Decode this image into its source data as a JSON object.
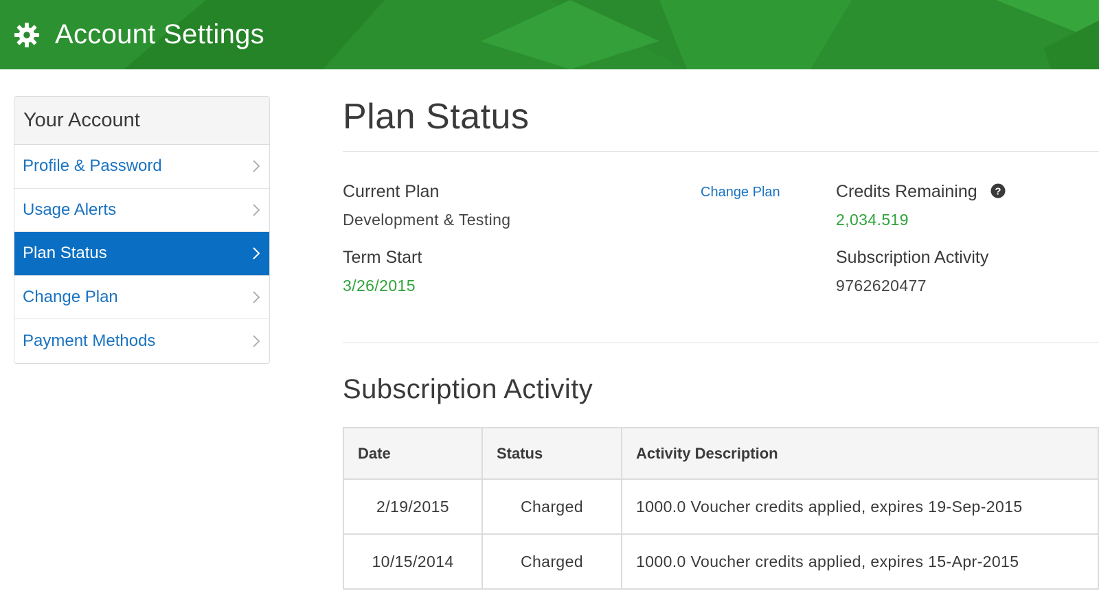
{
  "header": {
    "title": "Account Settings",
    "icon": "gear-icon",
    "color": "#2a8a2e"
  },
  "sidebar": {
    "heading": "Your Account",
    "items": [
      {
        "label": "Profile & Password",
        "active": false
      },
      {
        "label": "Usage Alerts",
        "active": false
      },
      {
        "label": "Plan Status",
        "active": true
      },
      {
        "label": "Change Plan",
        "active": false
      },
      {
        "label": "Payment Methods",
        "active": false
      }
    ],
    "active_color": "#0a6fc2",
    "link_color": "#1a73c0"
  },
  "main": {
    "title": "Plan Status",
    "current_plan_label": "Current Plan",
    "current_plan_value": "Development & Testing",
    "change_plan_link": "Change Plan",
    "term_start_label": "Term Start",
    "term_start_value": "3/26/2015",
    "credits_label": "Credits Remaining",
    "credits_help_icon": "question-circle-icon",
    "credits_value": "2,034.519",
    "subscription_activity_label": "Subscription Activity",
    "subscription_activity_value": "9762620477",
    "value_accent_color": "#2fa33a"
  },
  "activity": {
    "title": "Subscription Activity",
    "columns": [
      "Date",
      "Status",
      "Activity Description"
    ],
    "rows": [
      {
        "date": "2/19/2015",
        "status": "Charged",
        "description": "1000.0 Voucher credits applied, expires 19-Sep-2015"
      },
      {
        "date": "10/15/2014",
        "status": "Charged",
        "description": "1000.0 Voucher credits applied, expires 15-Apr-2015"
      }
    ]
  }
}
